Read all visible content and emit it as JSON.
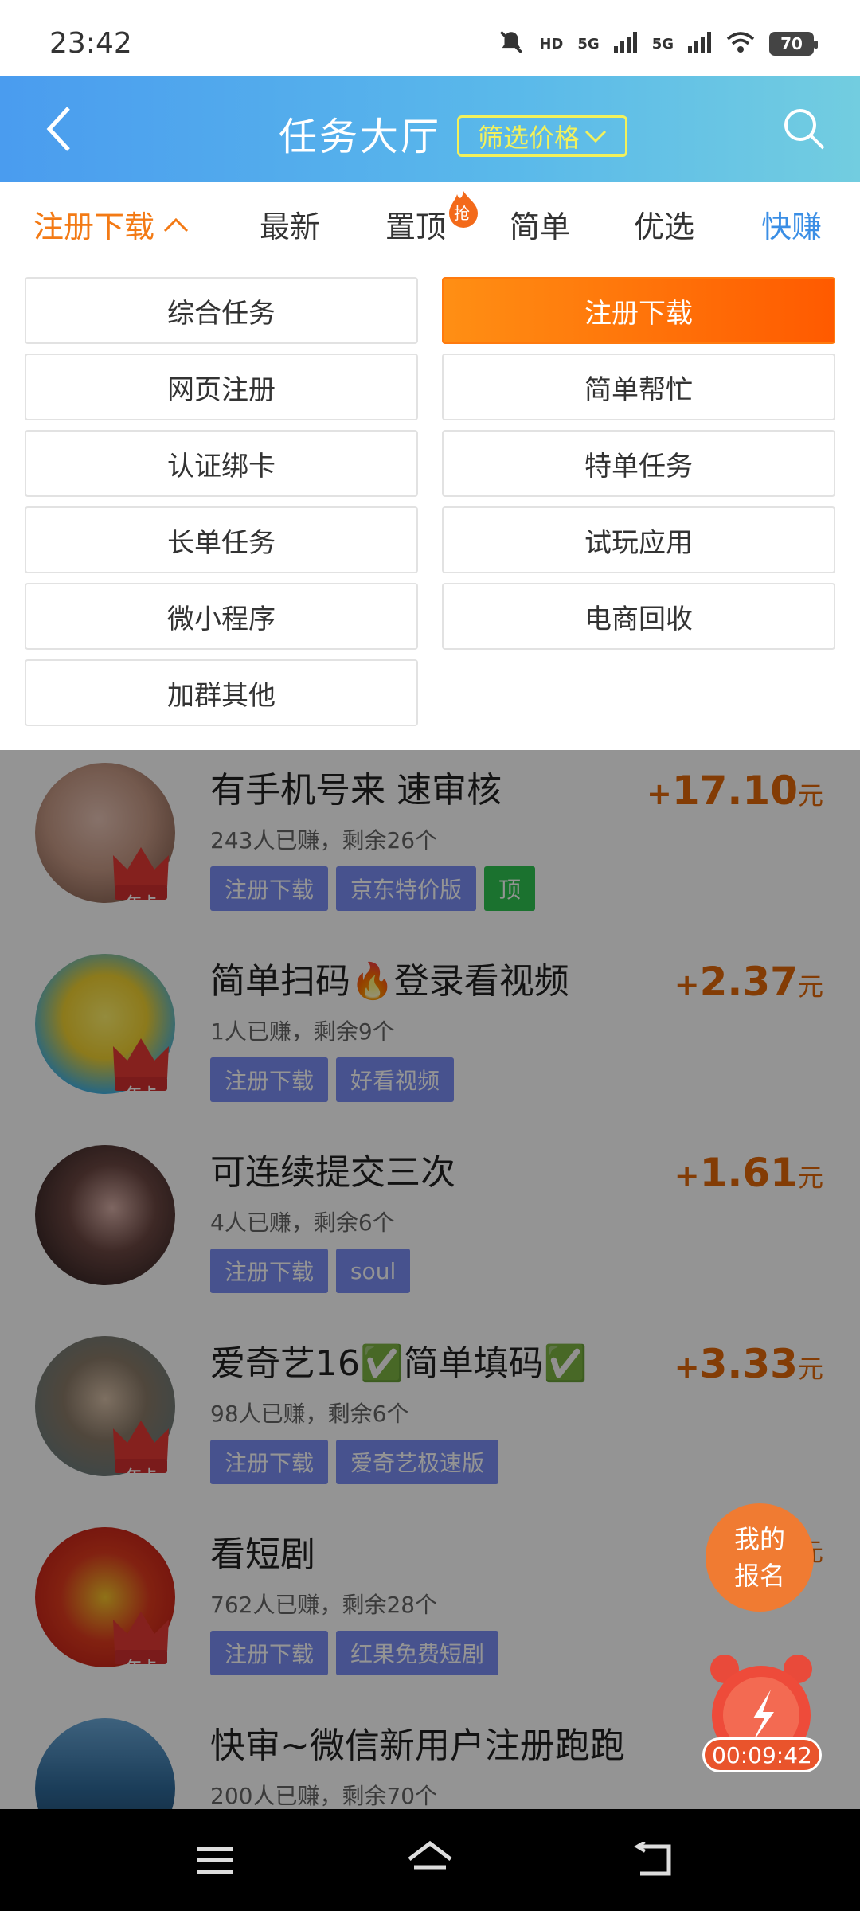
{
  "status_bar": {
    "time": "23:42",
    "network_1": "5G",
    "network_2": "5G",
    "hd_label": "HD",
    "battery": "70"
  },
  "header": {
    "title": "任务大厅",
    "filter_label": "筛选价格",
    "colors": {
      "gradient_start": "#4a9cef",
      "gradient_end": "#72cde0",
      "filter": "#f3f15b"
    }
  },
  "tabs": [
    {
      "label": "注册下载",
      "active": true
    },
    {
      "label": "最新"
    },
    {
      "label": "置顶",
      "badge": "抢"
    },
    {
      "label": "简单"
    },
    {
      "label": "优选"
    },
    {
      "label": "快赚"
    }
  ],
  "categories": [
    {
      "label": "综合任务"
    },
    {
      "label": "注册下载",
      "selected": true
    },
    {
      "label": "网页注册"
    },
    {
      "label": "简单帮忙"
    },
    {
      "label": "认证绑卡"
    },
    {
      "label": "特单任务"
    },
    {
      "label": "长单任务"
    },
    {
      "label": "试玩应用"
    },
    {
      "label": "微小程序"
    },
    {
      "label": "电商回收"
    },
    {
      "label": "加群其他"
    }
  ],
  "tasks": [
    {
      "title": "有手机号来 速审核",
      "meta": "243人已赚，剩余26个",
      "price_plus": "+",
      "price": "17.10",
      "unit": "元",
      "crown": "年卡",
      "tags": [
        "注册下载",
        "京东特价版"
      ],
      "top_tag": "顶"
    },
    {
      "title": "简单扫码🔥登录看视频",
      "meta": "1人已赚，剩余9个",
      "price_plus": "+",
      "price": "2.37",
      "unit": "元",
      "crown": "年卡",
      "tags": [
        "注册下载",
        "好看视频"
      ]
    },
    {
      "title": "可连续提交三次",
      "meta": "4人已赚，剩余6个",
      "price_plus": "+",
      "price": "1.61",
      "unit": "元",
      "crown": "",
      "tags": [
        "注册下载",
        "soul"
      ]
    },
    {
      "title": "爱奇艺16✅简单填码✅",
      "meta": "98人已赚，剩余6个",
      "price_plus": "+",
      "price": "3.33",
      "unit": "元",
      "crown": "年卡",
      "tags": [
        "注册下载",
        "爱奇艺极速版"
      ]
    },
    {
      "title": "看短剧",
      "meta": "762人已赚，剩余28个",
      "price_plus": "",
      "price": "",
      "unit": "元",
      "crown": "年卡",
      "tags": [
        "注册下载",
        "红果免费短剧"
      ]
    },
    {
      "title": "快审~微信新用户注册跑跑",
      "meta": "200人已赚，剩余70个",
      "price_plus": "",
      "price": "",
      "unit": "",
      "crown": "",
      "tags": []
    }
  ],
  "floating": {
    "signup_line1": "我的",
    "signup_line2": "报名",
    "timer": "00:09:42"
  },
  "colors": {
    "accent_orange": "#f37a15",
    "tag_blue": "#7b8ef5",
    "tag_green": "#2fc552",
    "price": "#e2680a"
  }
}
